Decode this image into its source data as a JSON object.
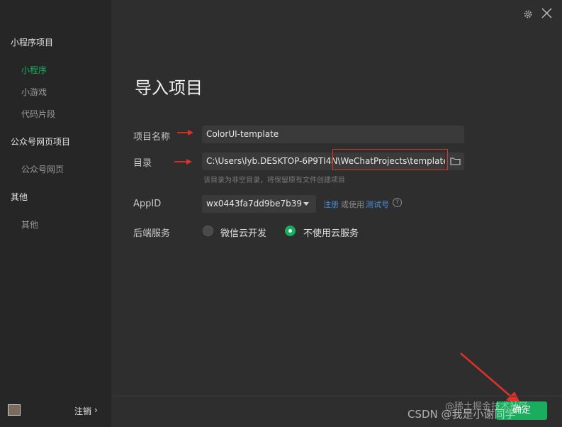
{
  "sidebar": {
    "groups": [
      {
        "label": "小程序项目",
        "items": [
          {
            "label": "小程序",
            "active": true
          },
          {
            "label": "小游戏"
          },
          {
            "label": "代码片段"
          }
        ]
      },
      {
        "label": "公众号网页项目",
        "items": [
          {
            "label": "公众号网页"
          }
        ]
      },
      {
        "label": "其他",
        "items": [
          {
            "label": "其他"
          }
        ]
      }
    ],
    "logout_label": "注销",
    "logout_chevron": "›",
    "avatar_icon": "user-avatar"
  },
  "window": {
    "settings_icon": "gear-icon",
    "close_icon": "close-icon"
  },
  "main": {
    "title": "导入项目",
    "project_name_label": "项目名称",
    "project_name_value": "ColorUI-template",
    "directory_label": "目录",
    "directory_value": "C:\\Users\\lyb.DESKTOP-6P9TI4N\\WeChatProjects\\template",
    "directory_hint": "该目录为非空目录，将保留原有文件创建项目",
    "appid_label": "AppID",
    "appid_value": "wx0443fa7dd9be7b39",
    "register_link": "注册",
    "or_use_text": "或使用",
    "test_account_link": "测试号",
    "help_icon": "?",
    "backend_label": "后端服务",
    "backend_options": [
      {
        "label": "微信云开发",
        "selected": false
      },
      {
        "label": "不使用云服务",
        "selected": true
      }
    ]
  },
  "footer": {
    "confirm_label": "确定"
  },
  "watermark": {
    "main": "CSDN @我是小谢同学",
    "juejin": "@稀土掘金技术社区"
  },
  "colors": {
    "accent": "#1aad5e",
    "link": "#4a8fdc",
    "annotation_red": "#e0302a"
  }
}
